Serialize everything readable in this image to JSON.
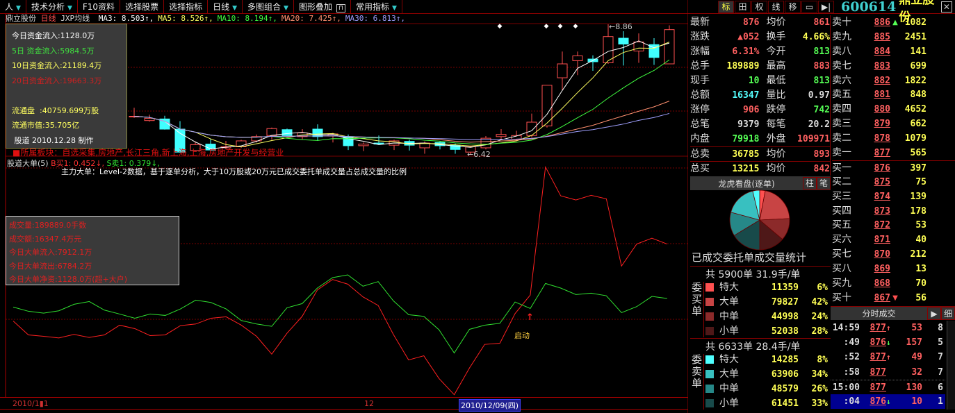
{
  "menubar": {
    "items": [
      {
        "label": "人",
        "dropdown": true
      },
      {
        "label": "技术分析",
        "dropdown": true
      },
      {
        "label": "F10资料",
        "dropdown": false
      },
      {
        "label": "选择股票",
        "dropdown": false
      },
      {
        "label": "选择指标",
        "dropdown": false
      },
      {
        "label": "日线",
        "dropdown": true
      },
      {
        "label": "多图组合",
        "dropdown": true
      },
      {
        "label": "图形叠加",
        "dropdown": false,
        "lock": true
      },
      {
        "label": "常用指标",
        "dropdown": true
      }
    ]
  },
  "legend": {
    "stock": "鼎立股份",
    "period": "日线",
    "indicator": "JXP均线",
    "ma": [
      {
        "label": "MA3: 8.503↑,",
        "color": "#ffffff"
      },
      {
        "label": "MA5: 8.526↑,",
        "color": "#ffff60"
      },
      {
        "label": "MA10: 8.194↑,",
        "color": "#40ff40"
      },
      {
        "label": "MA20: 7.425↑,",
        "color": "#ff9070"
      },
      {
        "label": "MA30: 6.813↑,",
        "color": "#a0a0ff"
      }
    ]
  },
  "info_box": {
    "lines": [
      {
        "text": "今日资金流入:1128.0万",
        "color": "#ffffff"
      },
      {
        "text": "5日 资金流入:5984.5万",
        "color": "#40e040"
      },
      {
        "text": "10日资金流入:21189.4万",
        "color": "#ffff60"
      },
      {
        "text": "20日资金流入:19663.3万",
        "color": "#d02020"
      },
      {
        "text": "",
        "color": "#ffffff"
      },
      {
        "text": "流通盘  :40759.699万股",
        "color": "#ffff60"
      },
      {
        "text": "流通市值:35.705亿",
        "color": "#ffff60"
      },
      {
        "text": " 股道 2010.12.28 制作",
        "color": "#ffffff"
      }
    ]
  },
  "sector_text": "■所属板块：自选采集,房地产,长江三角,新上海,上海,房地产开发与经营业",
  "indicator": {
    "name": "股道大单(5)",
    "b_label": "B买1: 0.452↓,",
    "s_label": "S卖1: 0.379↓,",
    "description": "主力大单：Level-2数据，基于逐单分析，大于10万股或20万元已成交委托单成交量占总成交量的比例",
    "launch_label": "启动",
    "launch_arrow": "↑"
  },
  "volume_box": {
    "lines": [
      "成交量:189889.0手数",
      "成交额:16347.4万元",
      "今日大单流入:7912.1万",
      "今日大单流出:6784.2万",
      "今日大单净资:1128.0万(超+大户)"
    ]
  },
  "time_axis": {
    "labels": [
      "2010/1▮1",
      "12"
    ],
    "cursor": "2010/12/09(四)"
  },
  "chart_data": [
    {
      "type": "candlestick",
      "title": "鼎立股份 日线",
      "annotations": {
        "high": "8.86",
        "low": "6.42"
      },
      "colors": {
        "up": "#ff5050",
        "down": "#40ffff"
      },
      "ohlc": [
        [
          7.14,
          7.3,
          7.11,
          7.14
        ],
        [
          7.06,
          7.17,
          7.04,
          7.1
        ],
        [
          7.09,
          7.15,
          6.89,
          6.9
        ],
        [
          6.9,
          7.05,
          6.46,
          6.47
        ],
        [
          6.5,
          6.67,
          6.49,
          6.61
        ],
        [
          6.62,
          6.72,
          6.5,
          6.51
        ],
        [
          6.55,
          6.68,
          6.52,
          6.57
        ],
        [
          6.57,
          6.7,
          6.55,
          6.68
        ],
        [
          6.68,
          6.8,
          6.65,
          6.76
        ],
        [
          6.78,
          6.93,
          6.7,
          6.91
        ],
        [
          6.89,
          6.91,
          6.76,
          6.78
        ],
        [
          6.76,
          6.9,
          6.71,
          6.83
        ],
        [
          6.9,
          6.99,
          6.68,
          6.76
        ],
        [
          6.77,
          6.83,
          6.65,
          6.81
        ],
        [
          6.76,
          6.8,
          6.51,
          6.59
        ],
        [
          6.59,
          6.65,
          6.49,
          6.62
        ],
        [
          6.64,
          6.78,
          6.61,
          6.62
        ],
        [
          6.6,
          6.7,
          6.51,
          6.68
        ],
        [
          6.67,
          6.7,
          6.5,
          6.6
        ],
        [
          6.55,
          6.67,
          6.44,
          6.64
        ],
        [
          6.65,
          6.67,
          6.52,
          6.59
        ],
        [
          6.6,
          6.63,
          6.44,
          6.52
        ],
        [
          6.47,
          6.59,
          6.42,
          6.57
        ],
        [
          6.55,
          6.77,
          6.52,
          6.73
        ],
        [
          6.76,
          6.9,
          6.72,
          6.8
        ],
        [
          6.71,
          6.87,
          6.68,
          6.78
        ],
        [
          6.78,
          7.19,
          6.74,
          7.03
        ],
        [
          6.96,
          7.72,
          6.93,
          7.72
        ],
        [
          7.86,
          8.35,
          7.63,
          8.12
        ],
        [
          8.18,
          8.35,
          7.91,
          8.27
        ],
        [
          8.21,
          8.28,
          7.99,
          8.16
        ],
        [
          8.14,
          8.86,
          8.12,
          8.63
        ],
        [
          8.6,
          8.73,
          8.09,
          8.49
        ],
        [
          8.36,
          8.69,
          8.14,
          8.53
        ],
        [
          8.48,
          8.6,
          8.1,
          8.24
        ],
        [
          8.12,
          8.84,
          8.12,
          8.76
        ]
      ],
      "ylim": [
        6.42,
        8.86
      ]
    },
    {
      "type": "line",
      "title": "股道大单(5)",
      "ylim": [
        0,
        100
      ],
      "series": [
        {
          "name": "B买1",
          "color": "#ff2020",
          "values": [
            32.8,
            26.8,
            26.2,
            25.5,
            27,
            25.7,
            26.8,
            31,
            29.5,
            26.5,
            26.8,
            30.8,
            31.5,
            34,
            34.6,
            31,
            26.2,
            18.5,
            27.5,
            34.8,
            46.2,
            50.7,
            48.7,
            43.2,
            39.5,
            27,
            16,
            17.8,
            8,
            1,
            12.5,
            22.7,
            23.2,
            36,
            44,
            99.2,
            86.8,
            85,
            87,
            85.5,
            56.5,
            66,
            68.5,
            66
          ]
        },
        {
          "name": "S卖1",
          "color": "#30e030",
          "values": [
            38.8,
            37,
            36.2,
            37.2,
            40,
            41.2,
            37.5,
            35.8,
            34,
            35.8,
            35.2,
            38,
            41.8,
            40.8,
            38,
            33,
            31.5,
            30.5,
            38.5,
            40.3,
            47,
            51.5,
            52.7,
            47.8,
            49.8,
            41.5,
            35.5,
            34.8,
            29,
            19,
            29.2,
            31,
            31.8,
            41,
            38.2,
            49,
            47,
            44.2,
            44.8,
            43.7,
            36.4,
            39,
            43.4,
            42.5
          ]
        }
      ]
    }
  ],
  "right_header": {
    "buttons": [
      "标",
      "田",
      "权",
      "线",
      "移",
      "▭",
      "▶|"
    ],
    "code": "600614",
    "name": "鼎立股份",
    "close": "✕"
  },
  "stats": [
    {
      "l": "最新",
      "v": "876",
      "c": "#ff6060",
      "l2": "均价",
      "v2": "861",
      "c2": "#ff6060"
    },
    {
      "l": "涨跌",
      "v": "▲052",
      "c": "#ff6060",
      "l2": "换手",
      "v2": "4.66%",
      "c2": "#ffff55"
    },
    {
      "l": "涨幅",
      "v": "6.31%",
      "c": "#ff6060",
      "l2": "今开",
      "v2": "813",
      "c2": "#55ff55"
    },
    {
      "l": "总手",
      "v": "189889",
      "c": "#ffff55",
      "l2": "最高",
      "v2": "883",
      "c2": "#ff6060"
    },
    {
      "l": "现手",
      "v": "10",
      "c": "#55ff55",
      "l2": "最低",
      "v2": "813",
      "c2": "#55ff55"
    },
    {
      "l": "总额",
      "v": "16347",
      "c": "#55ffff",
      "l2": "量比",
      "v2": "0.97",
      "c2": "#dddddd"
    },
    {
      "l": "涨停",
      "v": "906",
      "c": "#ff6060",
      "l2": "跌停",
      "v2": "742",
      "c2": "#55ff55"
    },
    {
      "l": "总笔",
      "v": "9379",
      "c": "#dddddd",
      "l2": "每笔",
      "v2": "20.2",
      "c2": "#dddddd"
    },
    {
      "l": "内盘",
      "v": "79918",
      "c": "#55ff55",
      "l2": "外盘",
      "v2": "109971",
      "c2": "#ff6060"
    },
    {
      "l": "总卖",
      "v": "36785",
      "c": "#ffff55",
      "l2": "均价",
      "v2": "893",
      "c2": "#ff6060"
    },
    {
      "l": "总买",
      "v": "13215",
      "c": "#ffff55",
      "l2": "均价",
      "v2": "842",
      "c2": "#ff6060"
    }
  ],
  "orderbook": {
    "asks": [
      {
        "l": "卖十",
        "p": "886",
        "m": "▲",
        "mc": "#55ff55",
        "q": "1082"
      },
      {
        "l": "卖九",
        "p": "885",
        "q": "2451"
      },
      {
        "l": "卖八",
        "p": "884",
        "q": "141"
      },
      {
        "l": "卖七",
        "p": "883",
        "q": "699"
      },
      {
        "l": "卖六",
        "p": "882",
        "q": "1822"
      },
      {
        "l": "卖五",
        "p": "881",
        "q": "848"
      },
      {
        "l": "卖四",
        "p": "880",
        "q": "4652"
      },
      {
        "l": "卖三",
        "p": "879",
        "q": "662"
      },
      {
        "l": "卖二",
        "p": "878",
        "q": "1079"
      },
      {
        "l": "卖一",
        "p": "877",
        "q": "565"
      }
    ],
    "bids": [
      {
        "l": "买一",
        "p": "876",
        "q": "397"
      },
      {
        "l": "买二",
        "p": "875",
        "q": "75"
      },
      {
        "l": "买三",
        "p": "874",
        "q": "139"
      },
      {
        "l": "买四",
        "p": "873",
        "q": "178"
      },
      {
        "l": "买五",
        "p": "872",
        "q": "53"
      },
      {
        "l": "买六",
        "p": "871",
        "q": "40"
      },
      {
        "l": "买七",
        "p": "870",
        "q": "212"
      },
      {
        "l": "买八",
        "p": "869",
        "q": "13"
      },
      {
        "l": "买九",
        "p": "868",
        "q": "70"
      },
      {
        "l": "买十",
        "p": "867",
        "m": "▼",
        "mc": "#ff5050",
        "q": "56"
      }
    ]
  },
  "longhu": {
    "title": "龙虎看盘(逐单)",
    "btn1": "柱",
    "btn2": "笔",
    "pie_title": "已成交委托单成交量统计",
    "buy": {
      "label": "委买单",
      "header": "共 5900单 31.9手/单",
      "rows": [
        {
          "n": "特大",
          "q": 11359,
          "pct": "6%",
          "color": "#ff5050"
        },
        {
          "n": "大单",
          "q": 79827,
          "pct": "42%",
          "color": "#c84444"
        },
        {
          "n": "中单",
          "q": 44998,
          "pct": "24%",
          "color": "#8c2a2a"
        },
        {
          "n": "小单",
          "q": 52038,
          "pct": "28%",
          "color": "#4e1818"
        }
      ]
    },
    "sell": {
      "label": "委卖单",
      "header": "共 6633单 28.4手/单",
      "rows": [
        {
          "n": "特大",
          "q": 14285,
          "pct": "8%",
          "color": "#50ffff"
        },
        {
          "n": "大单",
          "q": 63906,
          "pct": "34%",
          "color": "#38c0c0"
        },
        {
          "n": "中单",
          "q": 48579,
          "pct": "26%",
          "color": "#268888"
        },
        {
          "n": "小单",
          "q": 61451,
          "pct": "33%",
          "color": "#184a4a"
        }
      ]
    }
  },
  "ticks": {
    "title": "分时成交",
    "btn_play": "▶",
    "btn_detail": "细",
    "rows": [
      {
        "t": "14:59",
        "p": "877",
        "a": "↑",
        "ac": "#ff6060",
        "v": "53",
        "c": "8"
      },
      {
        "t": ":49",
        "p": "876",
        "a": "↓",
        "ac": "#55ff55",
        "v": "157",
        "c": "5"
      },
      {
        "t": ":52",
        "p": "877",
        "a": "↑",
        "ac": "#ff6060",
        "v": "49",
        "c": "7"
      },
      {
        "t": ":58",
        "p": "877",
        "a": "",
        "ac": "#ff6060",
        "v": "32",
        "c": "7"
      },
      {
        "t": "15:00",
        "p": "877",
        "a": "",
        "ac": "#ff6060",
        "v": "130",
        "c": "6"
      },
      {
        "t": ":04",
        "p": "876",
        "a": "↓",
        "ac": "#55ff55",
        "v": "10",
        "c": "1",
        "selected": true
      }
    ]
  }
}
